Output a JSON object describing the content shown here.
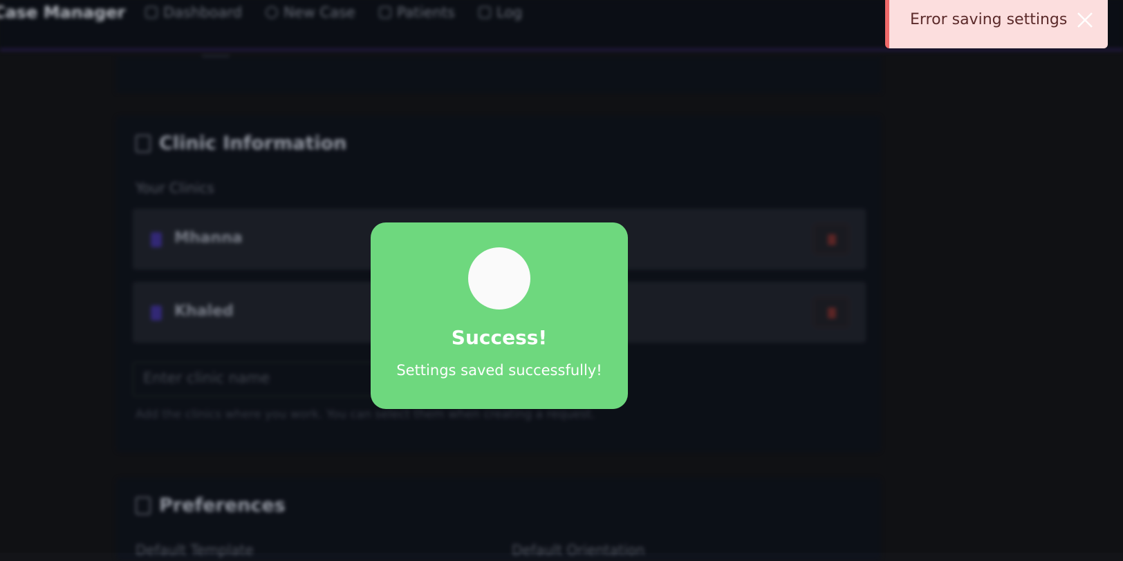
{
  "app": {
    "brand": "Case Manager",
    "nav": [
      {
        "label": "Dashboard",
        "icon": "dashboard-icon"
      },
      {
        "label": "New Case",
        "icon": "plus-circle-icon"
      },
      {
        "label": "Patients",
        "icon": "users-icon"
      },
      {
        "label": "Log",
        "icon": "log-icon"
      }
    ]
  },
  "clinic_section": {
    "title": "Clinic Information",
    "sub_label": "Your Clinics",
    "clinics": [
      {
        "name": "Mhanna"
      },
      {
        "name": "Khaled"
      }
    ],
    "input_placeholder": "Enter clinic name",
    "hint": "Add the clinics where you work. You can select them when creating a request."
  },
  "preferences": {
    "title": "Preferences",
    "label_template": "Default Template",
    "label_orientation": "Default Orientation"
  },
  "modal": {
    "title": "Success!",
    "message": "Settings saved successfully!",
    "color": "#6ed87e"
  },
  "toast": {
    "message": "Error saving settings",
    "color": "#fcdede",
    "accent": "#f06a6a"
  }
}
